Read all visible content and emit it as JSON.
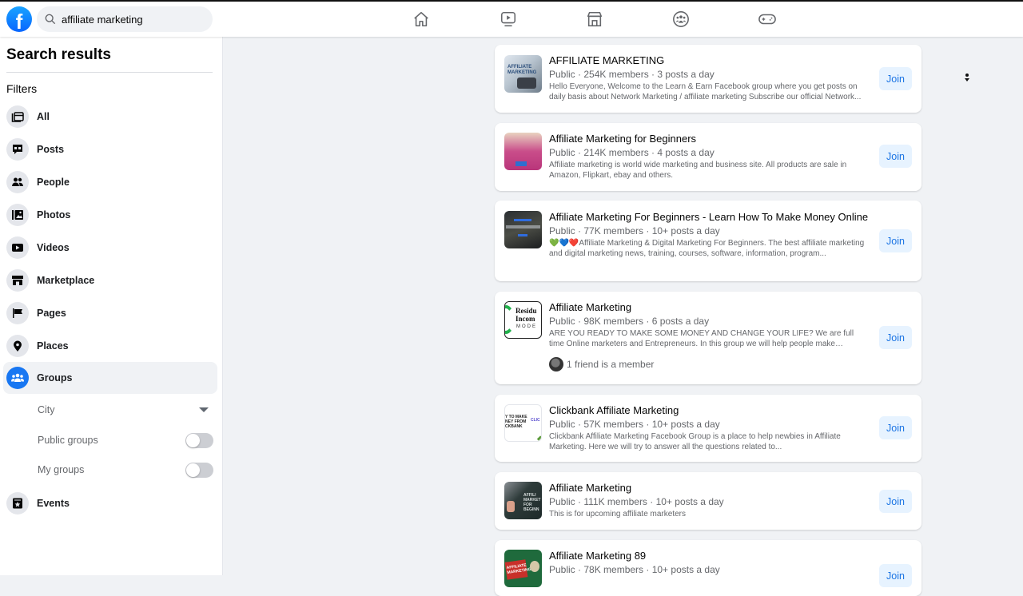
{
  "header": {
    "logo": "f",
    "search_value": "affiliate marketing",
    "nav_icons": [
      "home-icon",
      "watch-icon",
      "marketplace-icon",
      "groups-icon",
      "gaming-icon"
    ]
  },
  "sidebar": {
    "title": "Search results",
    "filters_label": "Filters",
    "items": [
      {
        "label": "All",
        "icon": "all-icon"
      },
      {
        "label": "Posts",
        "icon": "posts-icon"
      },
      {
        "label": "People",
        "icon": "people-icon"
      },
      {
        "label": "Photos",
        "icon": "photos-icon"
      },
      {
        "label": "Videos",
        "icon": "videos-icon"
      },
      {
        "label": "Marketplace",
        "icon": "marketplace-icon"
      },
      {
        "label": "Pages",
        "icon": "pages-icon"
      },
      {
        "label": "Places",
        "icon": "places-icon"
      },
      {
        "label": "Groups",
        "icon": "groups-icon",
        "active": true
      },
      {
        "label": "Events",
        "icon": "events-icon"
      }
    ],
    "group_filters": {
      "city": "City",
      "public_groups": "Public groups",
      "public_groups_on": false,
      "my_groups": "My groups",
      "my_groups_on": false
    }
  },
  "results": [
    {
      "title": "AFFILIATE MARKETING",
      "meta": "Public · 254K members · 3 posts a day",
      "desc": "Hello Everyone, Welcome to the Learn & Earn Facebook group where you get posts on daily basis about Network Marketing / affiliate marketing Subscribe our official Network...",
      "join": "Join"
    },
    {
      "title": "Affiliate Marketing for Beginners",
      "meta": "Public · 214K members · 4 posts a day",
      "desc": "Affiliate marketing is world wide marketing and business site. All products are sale in Amazon, Flipkart, ebay and others.",
      "join": "Join"
    },
    {
      "title": "Affiliate Marketing For Beginners - Learn How To Make Money Online",
      "meta": "Public · 77K members · 10+ posts a day",
      "desc": "💚💙❤️Affiliate Marketing & Digital Marketing For Beginners. The best affiliate marketing and digital marketing news, training, courses, software, information, program...",
      "join": "Join"
    },
    {
      "title": "Affiliate Marketing",
      "meta": "Public · 98K members · 6 posts a day",
      "desc": "ARE YOU READY TO MAKE SOME MONEY AND CHANGE YOUR LIFE? We are full time Online marketers and Entrepreneurs. In this group we will help people make passive...",
      "friends": "1 friend is a member",
      "join": "Join"
    },
    {
      "title": "Clickbank Affiliate Marketing",
      "meta": "Public · 57K members · 10+ posts a day",
      "desc": "Clickbank Affiliate Marketing Facebook Group is a place to help newbies in Affiliate Marketing. Here we will try to answer all the questions related to...",
      "join": "Join"
    },
    {
      "title": "Affiliate Marketing",
      "meta": "Public · 111K members · 10+ posts a day",
      "desc": "This is for upcoming affiliate marketers",
      "join": "Join"
    },
    {
      "title": "Affiliate Marketing 89",
      "meta": "Public · 78K members · 10+ posts a day",
      "join": "Join"
    }
  ],
  "colors": {
    "brand": "#1877f2",
    "join_bg": "#e7f3ff",
    "join_text": "#1b74e4"
  }
}
